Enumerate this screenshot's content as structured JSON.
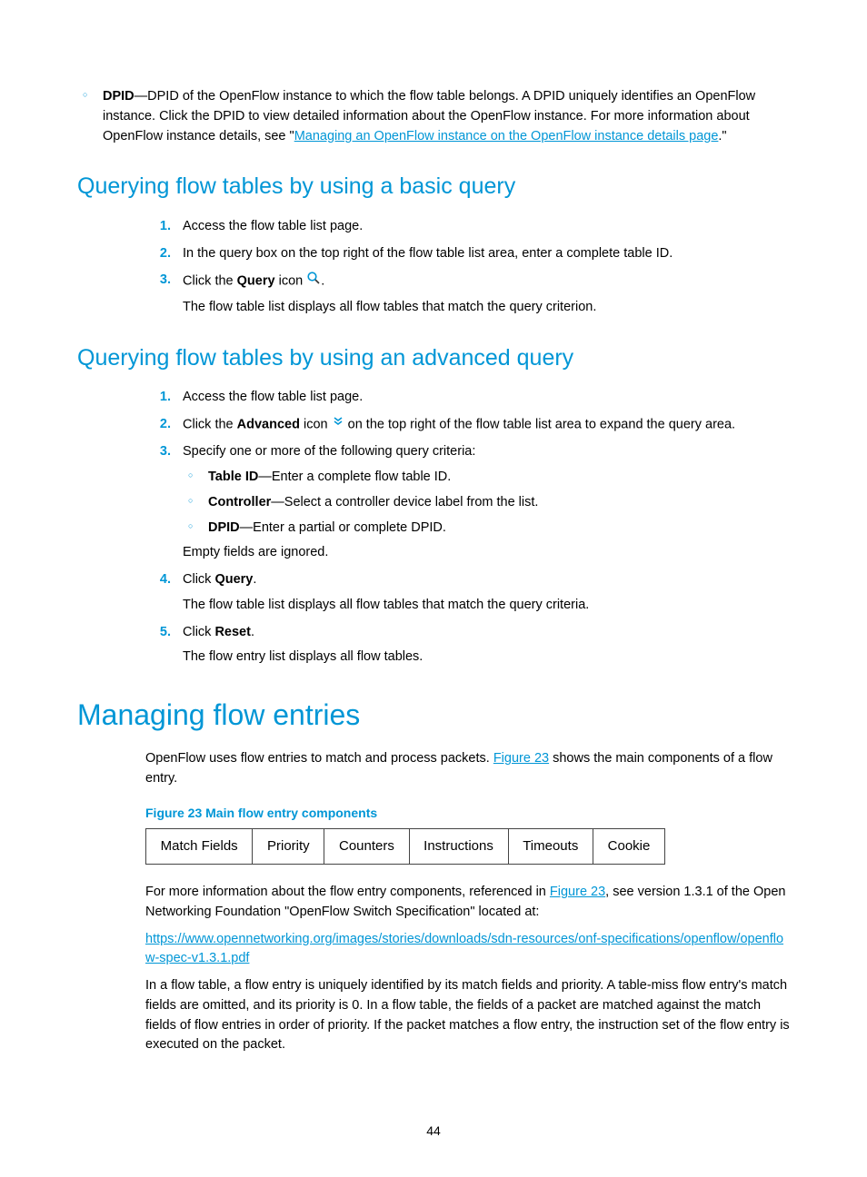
{
  "top_bullet": {
    "term": "DPID",
    "text": "—DPID of the OpenFlow instance to which the flow table belongs. A DPID uniquely identifies an OpenFlow instance. Click the DPID to view detailed information about the OpenFlow instance. For more information about OpenFlow instance details, see \"",
    "link": "Managing an OpenFlow instance on the OpenFlow instance details page",
    "after": ".\""
  },
  "h2_basic": "Querying flow tables by using a basic query",
  "basic_steps": {
    "s1": "Access the flow table list page.",
    "s2": "In the query box on the top right of the flow table list area, enter a complete table ID.",
    "s3_a": "Click the ",
    "s3_b": "Query",
    "s3_c": " icon ",
    "s3_d": ".",
    "s3_sub": "The flow table list displays all flow tables that match the query criterion."
  },
  "h2_adv": "Querying flow tables by using an advanced query",
  "adv_steps": {
    "s1": "Access the flow table list page.",
    "s2_a": "Click the ",
    "s2_b": "Advanced",
    "s2_c": " icon ",
    "s2_d": " on the top right of the flow table list area to expand the query area.",
    "s3": "Specify one or more of the following query criteria:",
    "criteria": {
      "c1_term": "Table ID",
      "c1_text": "—Enter a complete flow table ID.",
      "c2_term": "Controller",
      "c2_text": "—Select a controller device label from the list.",
      "c3_term": "DPID",
      "c3_text": "—Enter a partial or complete DPID."
    },
    "s3_sub": "Empty fields are ignored.",
    "s4_a": "Click ",
    "s4_b": "Query",
    "s4_c": ".",
    "s4_sub": "The flow table list displays all flow tables that match the query criteria.",
    "s5_a": "Click ",
    "s5_b": "Reset",
    "s5_c": ".",
    "s5_sub": "The flow entry list displays all flow tables."
  },
  "h1_entries": "Managing flow entries",
  "entries": {
    "p1_a": "OpenFlow uses flow entries to match and process packets. ",
    "p1_link": "Figure 23",
    "p1_b": " shows the main components of a flow entry.",
    "figcap": "Figure 23 Main flow entry components",
    "cells": {
      "c1": "Match Fields",
      "c2": "Priority",
      "c3": "Counters",
      "c4": "Instructions",
      "c5": "Timeouts",
      "c6": "Cookie"
    },
    "p2_a": "For more information about the flow entry components, referenced in ",
    "p2_link": "Figure 23",
    "p2_b": ", see version 1.3.1 of the Open Networking Foundation \"OpenFlow Switch Specification\" located at:",
    "url": "https://www.opennetworking.org/images/stories/downloads/sdn-resources/onf-specifications/openflow/openflow-spec-v1.3.1.pdf",
    "p3": "In a flow table, a flow entry is uniquely identified by its match fields and priority. A table-miss flow entry's match fields are omitted, and its priority is 0. In a flow table, the fields of a packet are matched against the match fields of flow entries in order of priority. If the packet matches a flow entry, the instruction set of the flow entry is executed on the packet."
  },
  "pagenum": "44"
}
